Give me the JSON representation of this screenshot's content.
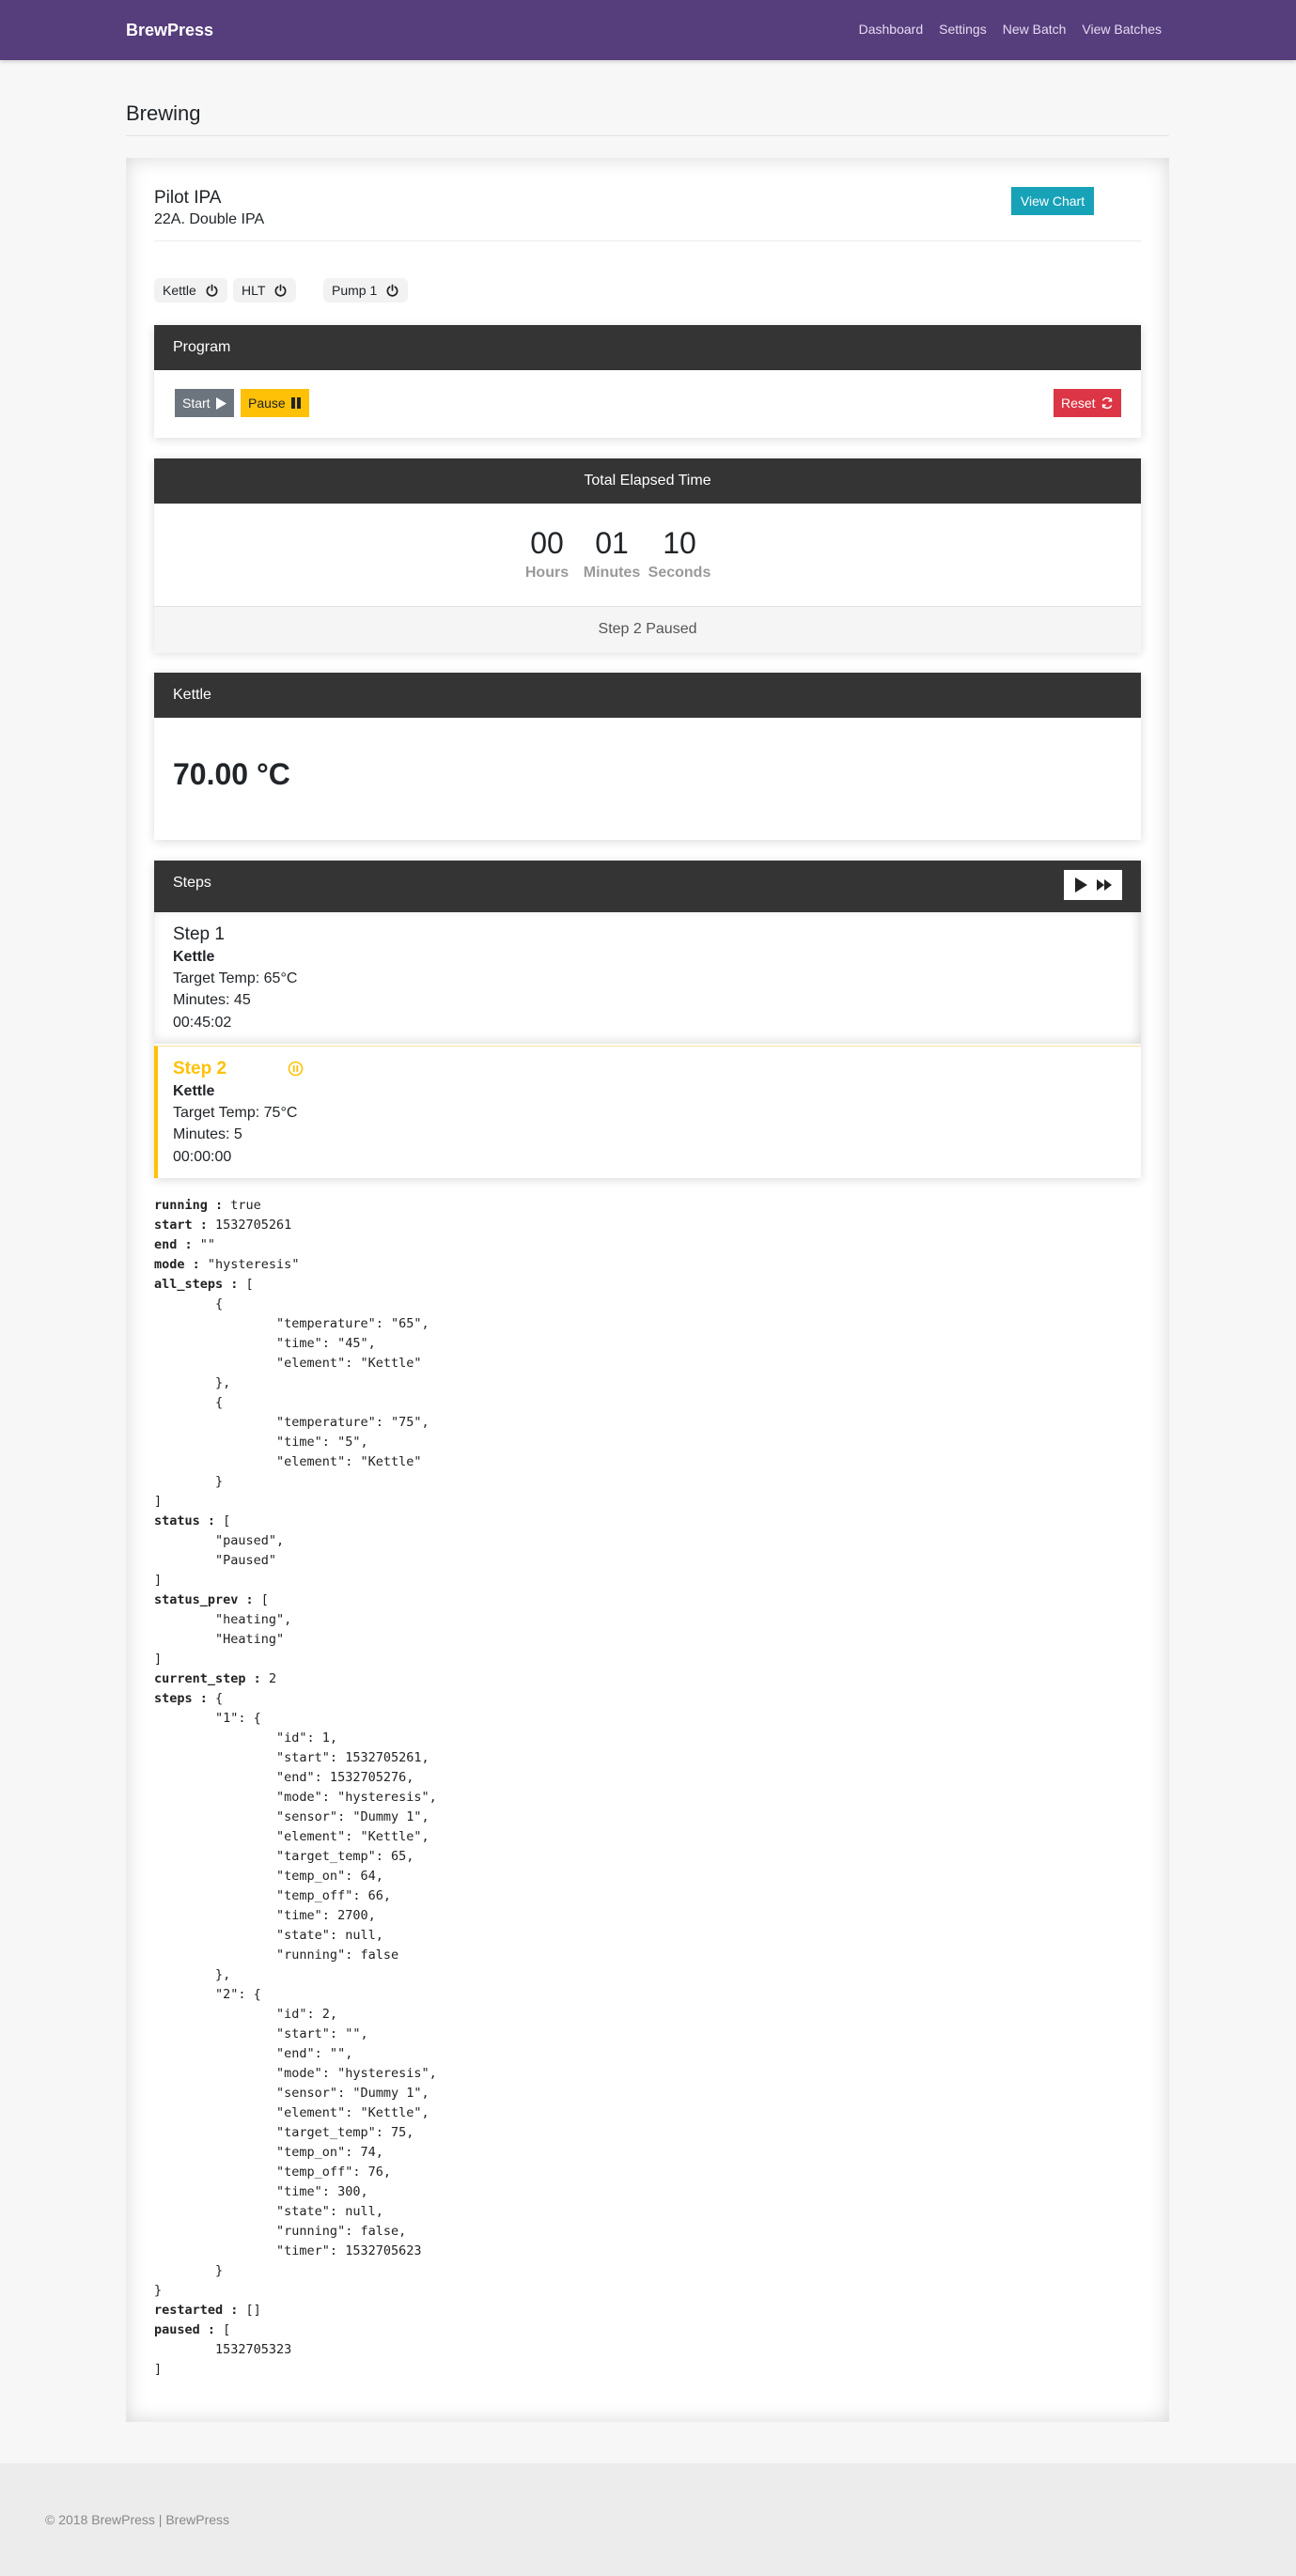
{
  "nav": {
    "brand": "BrewPress",
    "links": [
      "Dashboard",
      "Settings",
      "New Batch",
      "View Batches"
    ]
  },
  "page_title": "Brewing",
  "batch": {
    "name": "Pilot IPA",
    "style": "22A. Double IPA",
    "view_chart_label": "View Chart"
  },
  "toggles": [
    "Kettle",
    "HLT",
    "Pump 1"
  ],
  "program": {
    "title": "Program",
    "start_label": "Start",
    "pause_label": "Pause",
    "reset_label": "Reset"
  },
  "elapsed": {
    "title": "Total Elapsed Time",
    "hours": "00",
    "minutes": "01",
    "seconds": "10",
    "hours_label": "Hours",
    "minutes_label": "Minutes",
    "seconds_label": "Seconds",
    "status": "Step 2 Paused"
  },
  "kettle": {
    "title": "Kettle",
    "temperature": "70.00 °C"
  },
  "steps": {
    "title": "Steps",
    "items": [
      {
        "title": "Step 1",
        "element": "Kettle",
        "target": "Target Temp: 65°C",
        "minutes": "Minutes: 45",
        "time": "00:45:02"
      },
      {
        "title": "Step 2",
        "element": "Kettle",
        "target": "Target Temp: 75°C",
        "minutes": "Minutes: 5",
        "time": "00:00:00"
      }
    ]
  },
  "dump_lines": [
    [
      "running",
      " : true"
    ],
    [
      "start",
      " : 1532705261"
    ],
    [
      "end",
      " : \"\""
    ],
    [
      "mode",
      " : \"hysteresis\""
    ],
    [
      "all_steps",
      " : ["
    ],
    [
      "",
      "        {"
    ],
    [
      "",
      "                \"temperature\": \"65\","
    ],
    [
      "",
      "                \"time\": \"45\","
    ],
    [
      "",
      "                \"element\": \"Kettle\""
    ],
    [
      "",
      "        },"
    ],
    [
      "",
      "        {"
    ],
    [
      "",
      "                \"temperature\": \"75\","
    ],
    [
      "",
      "                \"time\": \"5\","
    ],
    [
      "",
      "                \"element\": \"Kettle\""
    ],
    [
      "",
      "        }"
    ],
    [
      "",
      "]"
    ],
    [
      "status",
      " : ["
    ],
    [
      "",
      "        \"paused\","
    ],
    [
      "",
      "        \"Paused\""
    ],
    [
      "",
      "]"
    ],
    [
      "status_prev",
      " : ["
    ],
    [
      "",
      "        \"heating\","
    ],
    [
      "",
      "        \"Heating\""
    ],
    [
      "",
      "]"
    ],
    [
      "current_step",
      " : 2"
    ],
    [
      "steps",
      " : {"
    ],
    [
      "",
      "        \"1\": {"
    ],
    [
      "",
      "                \"id\": 1,"
    ],
    [
      "",
      "                \"start\": 1532705261,"
    ],
    [
      "",
      "                \"end\": 1532705276,"
    ],
    [
      "",
      "                \"mode\": \"hysteresis\","
    ],
    [
      "",
      "                \"sensor\": \"Dummy 1\","
    ],
    [
      "",
      "                \"element\": \"Kettle\","
    ],
    [
      "",
      "                \"target_temp\": 65,"
    ],
    [
      "",
      "                \"temp_on\": 64,"
    ],
    [
      "",
      "                \"temp_off\": 66,"
    ],
    [
      "",
      "                \"time\": 2700,"
    ],
    [
      "",
      "                \"state\": null,"
    ],
    [
      "",
      "                \"running\": false"
    ],
    [
      "",
      "        },"
    ],
    [
      "",
      "        \"2\": {"
    ],
    [
      "",
      "                \"id\": 2,"
    ],
    [
      "",
      "                \"start\": \"\","
    ],
    [
      "",
      "                \"end\": \"\","
    ],
    [
      "",
      "                \"mode\": \"hysteresis\","
    ],
    [
      "",
      "                \"sensor\": \"Dummy 1\","
    ],
    [
      "",
      "                \"element\": \"Kettle\","
    ],
    [
      "",
      "                \"target_temp\": 75,"
    ],
    [
      "",
      "                \"temp_on\": 74,"
    ],
    [
      "",
      "                \"temp_off\": 76,"
    ],
    [
      "",
      "                \"time\": 300,"
    ],
    [
      "",
      "                \"state\": null,"
    ],
    [
      "",
      "                \"running\": false,"
    ],
    [
      "",
      "                \"timer\": 1532705623"
    ],
    [
      "",
      "        }"
    ],
    [
      "",
      "}"
    ],
    [
      "restarted",
      " : []"
    ],
    [
      "paused",
      " : ["
    ],
    [
      "",
      "        1532705323"
    ],
    [
      "",
      "]"
    ]
  ],
  "footer": "© 2018 BrewPress | BrewPress",
  "colors": {
    "navbar": "#563d7c",
    "panel_header": "#343434",
    "info": "#17a2b8",
    "warning": "#ffc107",
    "danger": "#dc3545",
    "secondary": "#6c757d"
  }
}
